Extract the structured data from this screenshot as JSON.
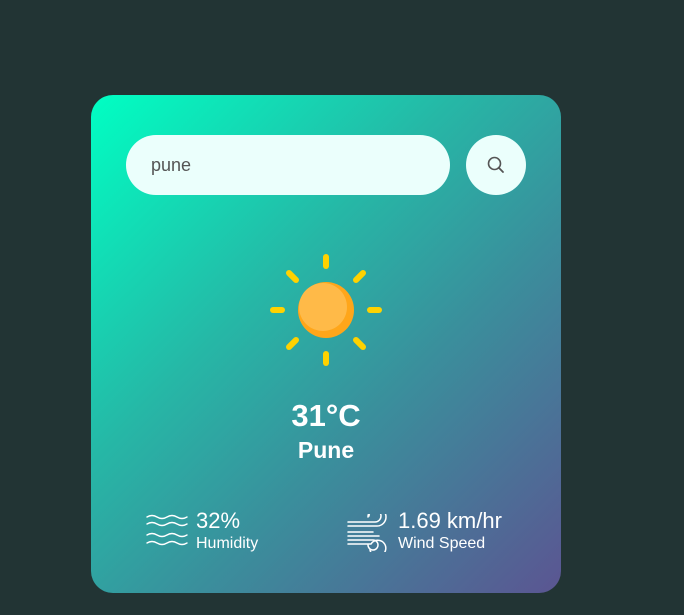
{
  "search": {
    "value": "pune",
    "button_icon": "search-icon"
  },
  "weather": {
    "icon": "sun-icon",
    "temperature": "31°C",
    "city": "Pune"
  },
  "details": {
    "humidity": {
      "icon": "humidity-waves-icon",
      "value": "32%",
      "label": "Humidity"
    },
    "wind": {
      "icon": "wind-icon",
      "value": "1.69 km/hr",
      "label": "Wind Speed"
    }
  },
  "colors": {
    "page_background": "#223434",
    "card_gradient_start": "#00ffc3",
    "card_gradient_end": "#5b5592",
    "input_background": "#ebfffc",
    "sun_body": "#ffb23f",
    "sun_rays": "#ffd200"
  }
}
